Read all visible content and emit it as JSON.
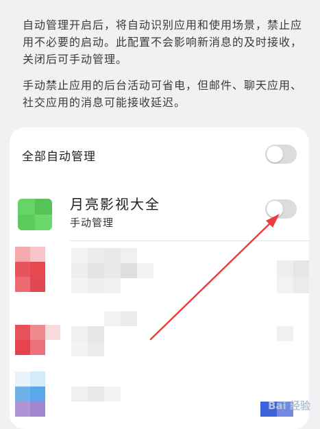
{
  "description": {
    "paragraph1": "自动管理开启后，将自动识别应用和使用场景，禁止应用不必要的启动。此配置不会影响新消息的及时接收，关闭后可手动管理。",
    "paragraph2": "手动禁止应用的后台活动可省电，但邮件、聊天应用、社交应用的消息可能接收延迟。"
  },
  "manage_all": {
    "label": "全部自动管理",
    "toggle_on": false
  },
  "apps": [
    {
      "name": "月亮影视大全",
      "subtitle": "手动管理",
      "toggle_on": false,
      "icon_color": "#5fcc5c"
    }
  ],
  "annotation": {
    "arrow_color": "#e8413b"
  },
  "watermark": {
    "text": "Bai 经验"
  }
}
